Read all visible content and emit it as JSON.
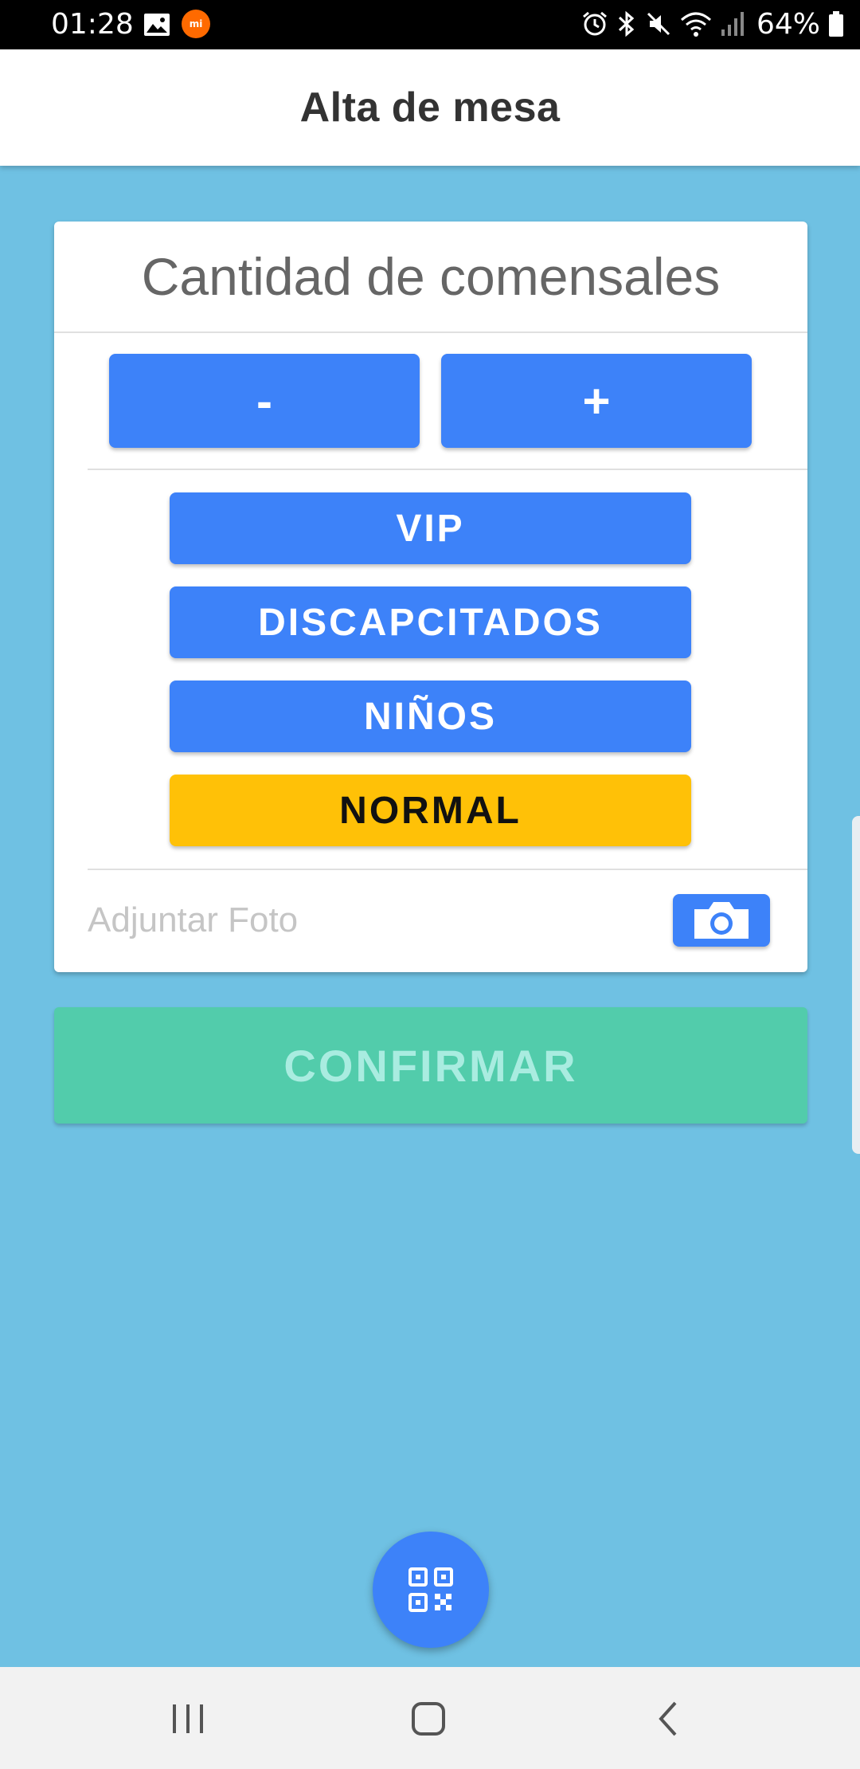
{
  "status_bar": {
    "time": "01:28",
    "battery": "64%",
    "mi_badge": "mi"
  },
  "app_bar": {
    "title": "Alta de mesa"
  },
  "card": {
    "heading": "Cantidad de comensales",
    "minus_label": "-",
    "plus_label": "+",
    "types": [
      {
        "label": "VIP",
        "color": "#3d82f9"
      },
      {
        "label": "DISCAPCITADOS",
        "color": "#3d82f9"
      },
      {
        "label": "NIÑOS",
        "color": "#3d82f9"
      },
      {
        "label": "NORMAL",
        "color": "#ffc107"
      }
    ],
    "attach_label": "Adjuntar Foto"
  },
  "confirm_label": "CONFIRMAR",
  "colors": {
    "background": "#6fc1e3",
    "primary": "#3d82f9",
    "selected": "#ffc107",
    "confirm": "#52ccab"
  },
  "icons": {
    "camera": "camera-icon",
    "fab": "qr-code-icon",
    "nav": [
      "recents-icon",
      "home-icon",
      "back-icon"
    ]
  }
}
